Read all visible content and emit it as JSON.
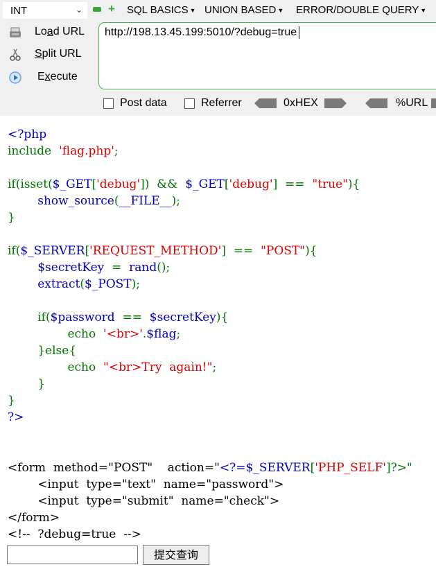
{
  "hackbar": {
    "type_select": "INT",
    "menus": {
      "sql_basics": "SQL BASICS",
      "union_based": "UNION BASED",
      "error_double": "ERROR/DOUBLE QUERY"
    },
    "actions": {
      "load_pre": "Lo",
      "load_u": "a",
      "load_post": "d URL",
      "split_u": "S",
      "split_post": "plit URL",
      "exec_pre": "E",
      "exec_u": "x",
      "exec_post": "ecute"
    },
    "url": "http://198.13.45.199:5010/?debug=true",
    "options": {
      "post_data": "Post data",
      "referrer": "Referrer",
      "hex": "0xHEX",
      "url_enc": "%URL"
    }
  },
  "source": {
    "l1": "<?php",
    "l2_kw": "include",
    "l2_str": "'flag.php'",
    "l2_end": ";",
    "l4a": "if(isset(",
    "l4b": "$_GET",
    "l4c": "[",
    "l4d": "'debug'",
    "l4e": "])  &&  ",
    "l4f": "$_GET",
    "l4g": "[",
    "l4h": "'debug'",
    "l4i": "]  ==  ",
    "l4j": "\"true\"",
    "l4k": "){",
    "l5a": "show_source",
    "l5b": "(",
    "l5c": "__FILE__",
    "l5d": ");",
    "l6": "}",
    "l8a": "if(",
    "l8b": "$_SERVER",
    "l8c": "[",
    "l8d": "'REQUEST_METHOD'",
    "l8e": "]  ==  ",
    "l8f": "\"POST\"",
    "l8g": "){",
    "l9a": "$secretKey",
    "l9b": "  =  ",
    "l9c": "rand",
    "l9d": "();",
    "l10a": "extract",
    "l10b": "(",
    "l10c": "$_POST",
    "l10d": ");",
    "l12a": "if(",
    "l12b": "$password",
    "l12c": "  ==  ",
    "l12d": "$secretKey",
    "l12e": "){",
    "l13a": "echo  ",
    "l13b": "'<br>'",
    "l13c": ".",
    "l13d": "$flag",
    "l13e": ";",
    "l14": "}else{",
    "l15a": "echo  ",
    "l15b": "\"<br>Try  again!\"",
    "l15c": ";",
    "l16": "}",
    "l17": "}",
    "l18": "?>"
  },
  "html_source": {
    "f1": "<form  method=\"POST\"    action=\"",
    "f1_php": "<?=$_SERVER",
    "f1_b": "[",
    "f1_str": "'PHP_SELF'",
    "f1_c": "]?>\"",
    "f2": "        <input  type=\"text\"  name=\"password\">",
    "f3": "        <input  type=\"submit\"  name=\"check\">",
    "f4": "</form>",
    "f5": "<!--  ?debug=true  -->"
  },
  "form": {
    "submit_label": "提交查询",
    "password_value": ""
  }
}
